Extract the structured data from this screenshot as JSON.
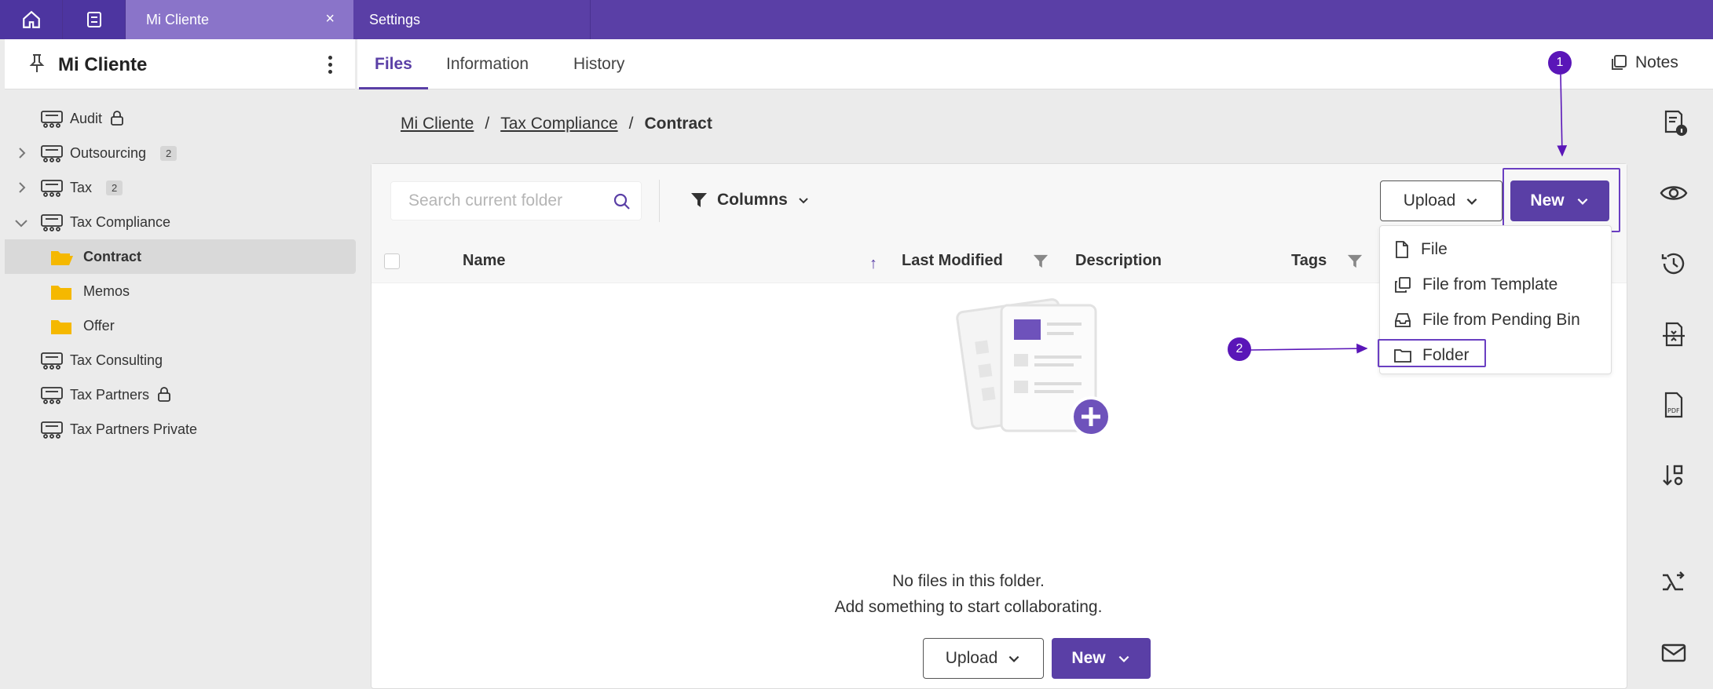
{
  "topbar": {
    "home_icon": "home-icon",
    "save_icon": "save-icon",
    "tabs": [
      {
        "label": "Mi Cliente",
        "active": true
      },
      {
        "label": "Settings",
        "active": false
      }
    ],
    "close_symbol": "×"
  },
  "client": {
    "title": "Mi Cliente"
  },
  "header": {
    "tabs": [
      {
        "label": "Files",
        "active": true
      },
      {
        "label": "Information",
        "active": false
      },
      {
        "label": "History",
        "active": false
      }
    ],
    "notes_label": "Notes"
  },
  "sidebar": {
    "items": [
      {
        "label": "Audit",
        "icon": "team-icon",
        "locked": true
      },
      {
        "label": "Outsourcing",
        "icon": "team-icon",
        "badge": "2",
        "expandable": true
      },
      {
        "label": "Tax",
        "icon": "team-icon",
        "badge": "2",
        "expandable": true
      },
      {
        "label": "Tax Compliance",
        "icon": "team-icon",
        "expanded": true
      },
      {
        "label": "Contract",
        "icon": "folder-open-icon",
        "selected": true
      },
      {
        "label": "Memos",
        "icon": "folder-icon"
      },
      {
        "label": "Offer",
        "icon": "folder-icon"
      },
      {
        "label": "Tax Consulting",
        "icon": "team-icon"
      },
      {
        "label": "Tax Partners",
        "icon": "team-icon",
        "locked": true
      },
      {
        "label": "Tax Partners Private",
        "icon": "team-icon"
      }
    ]
  },
  "breadcrumb": {
    "items": [
      "Mi Cliente",
      "Tax Compliance",
      "Contract"
    ],
    "separator": "/"
  },
  "toolbar": {
    "search_placeholder": "Search current folder",
    "columns_label": "Columns",
    "upload_label": "Upload",
    "new_label": "New"
  },
  "table": {
    "headers": [
      "Name",
      "Last Modified",
      "Description",
      "Tags"
    ],
    "sort_indicator": "↑"
  },
  "new_menu": {
    "items": [
      {
        "label": "File",
        "icon": "file-icon"
      },
      {
        "label": "File from Template",
        "icon": "copy-icon"
      },
      {
        "label": "File from Pending Bin",
        "icon": "inbox-icon"
      },
      {
        "label": "Folder",
        "icon": "folder-outline-icon"
      }
    ]
  },
  "empty_state": {
    "line1": "No files in this folder.",
    "line2": "Add something to start collaborating.",
    "upload_label": "Upload",
    "new_label": "New"
  },
  "annotations": {
    "step1": "1",
    "step2": "2"
  },
  "colors": {
    "brand": "#5a3fa6",
    "annotation": "#5a16b8",
    "folder": "#f5b800"
  }
}
